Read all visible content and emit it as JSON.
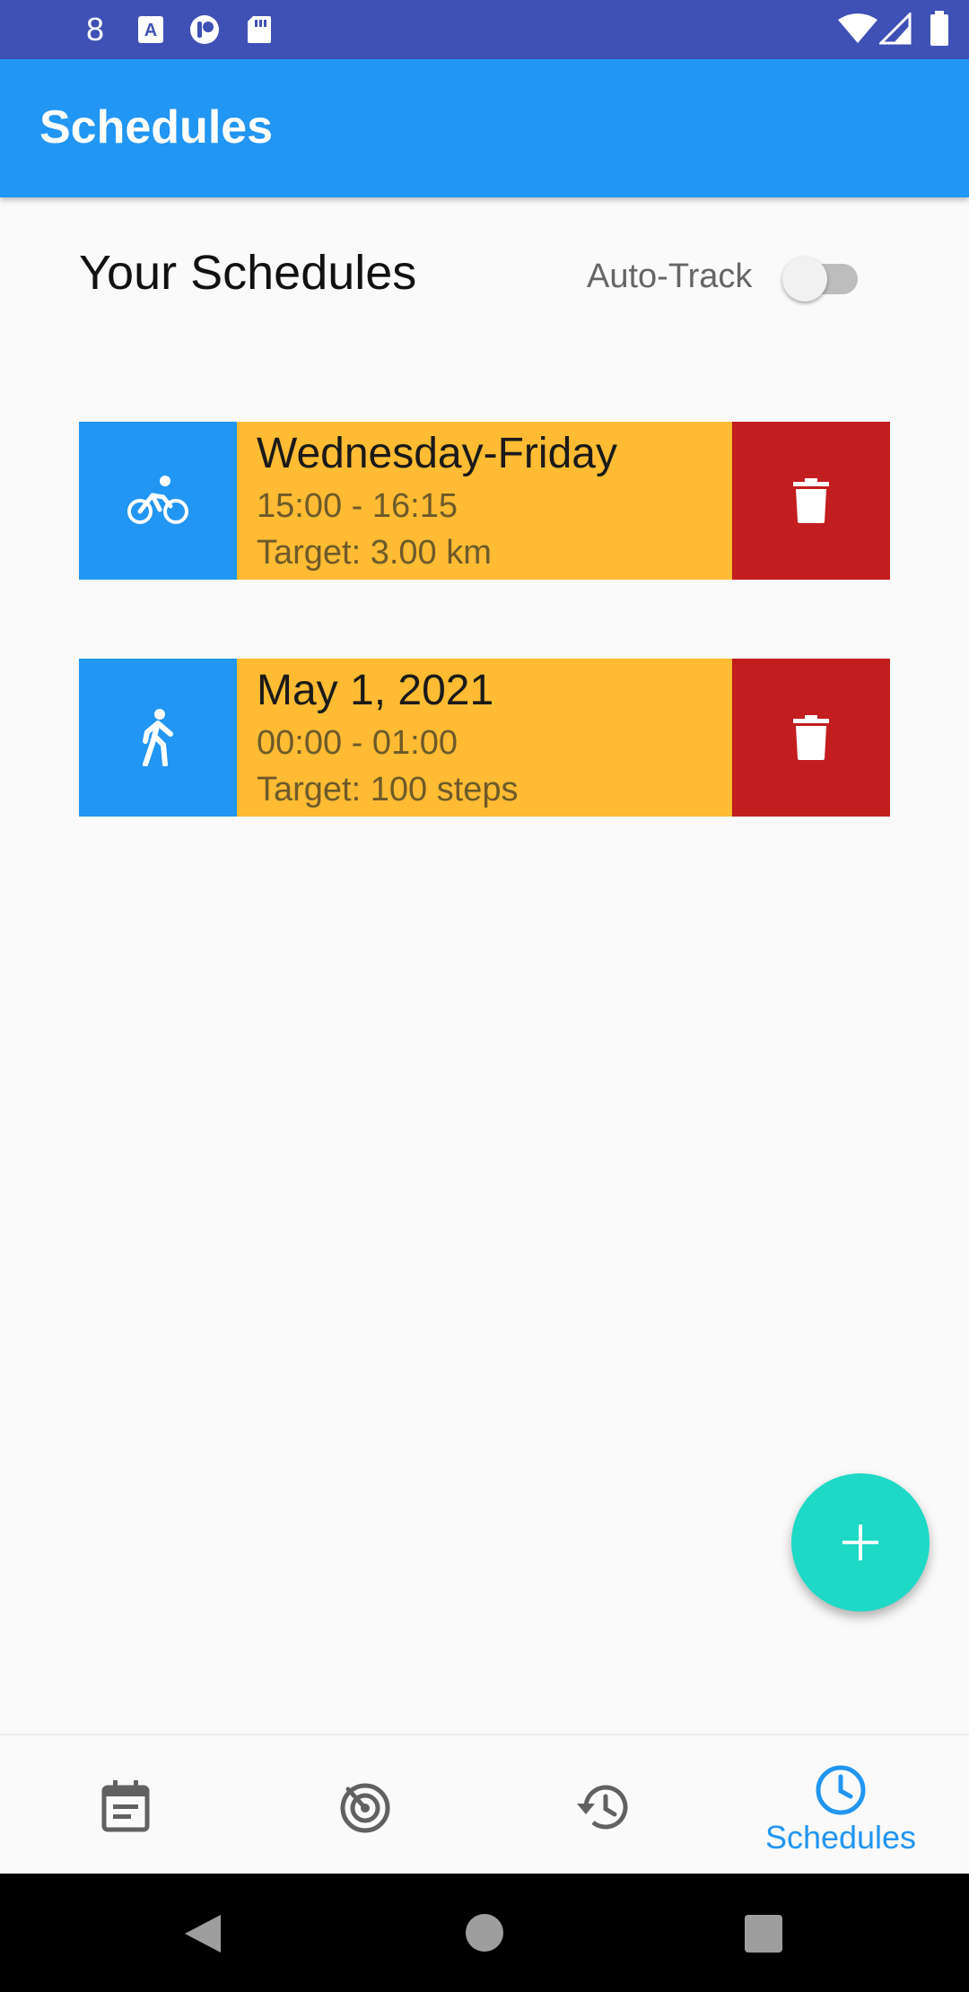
{
  "status_bar": {
    "time": "8"
  },
  "app_bar": {
    "title": "Schedules"
  },
  "header": {
    "title": "Your Schedules",
    "auto_track_label": "Auto-Track",
    "auto_track_on": false
  },
  "schedules": [
    {
      "activity": "bike-icon",
      "title": "Wednesday-Friday",
      "time": "15:00 - 16:15",
      "target": "Target: 3.00 km"
    },
    {
      "activity": "walk-icon",
      "title": "May 1, 2021",
      "time": "00:00 - 01:00",
      "target": "Target: 100 steps"
    }
  ],
  "bottom_nav": {
    "items": [
      {
        "icon": "calendar-note-icon",
        "label": ""
      },
      {
        "icon": "radar-icon",
        "label": ""
      },
      {
        "icon": "history-icon",
        "label": ""
      },
      {
        "icon": "clock-icon",
        "label": "Schedules",
        "active": true
      }
    ]
  },
  "colors": {
    "status_bar": "#3f51b5",
    "app_bar": "#2196f3",
    "card_body": "#ffbb33",
    "delete": "#c21d1f",
    "fab": "#1dd9c6"
  }
}
